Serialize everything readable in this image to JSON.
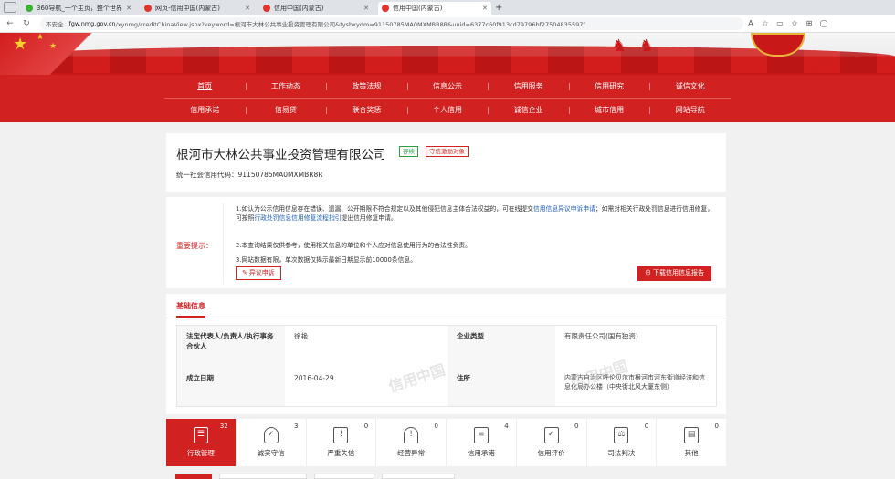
{
  "browser": {
    "tabs": [
      {
        "title": "360导航_一个主页，整个世界",
        "active": false
      },
      {
        "title": "网页-信用中国(内蒙古)",
        "active": false
      },
      {
        "title": "信用中国(内蒙古)",
        "active": false
      },
      {
        "title": "信用中国(内蒙古)",
        "active": true
      }
    ],
    "address": {
      "security": "不安全",
      "host": "fgw.nmg.gov.cn",
      "path": "/xynmg/creditChinaView.jspx?keyword=根河市大林公共事业投资管理有限公司&tyshxydm=91150785MA0MXMBR8R&uuid=6377c60f913cd79796bf27504835597f"
    }
  },
  "nav": {
    "row1": [
      "首页",
      "工作动态",
      "政策法规",
      "信息公示",
      "信用服务",
      "信用研究",
      "诚信文化"
    ],
    "row2": [
      "信用承诺",
      "信易贷",
      "联合奖惩",
      "个人信用",
      "诚信企业",
      "城市信用",
      "网站导航"
    ]
  },
  "company": {
    "name": "根河市大林公共事业投资管理有限公司",
    "status_badge": "存续",
    "credit_badge": "守信激励对象",
    "uscc_label": "统一社会信用代码：",
    "uscc": "91150785MA0MXMBR8R"
  },
  "notice": {
    "label": "重要提示：",
    "line1_a": "1.如认为公示信用信息存在错误、遗漏、公开期限不符合规定以及其他侵犯信息主体合法权益的，可在线提交",
    "line1_link1": "信用信息异议申诉申请",
    "line1_b": "；如需对相关行政处罚信息进行信用修复，可按照",
    "line1_link2": "行政处罚信息信用修复流程指引",
    "line1_c": "提出信用修复申请。",
    "line2": "2.本查询结果仅供参考，使用相关信息的单位和个人应对信息使用行为的合法性负责。",
    "line3": "3.网站数据有限，单次数据仅揭示最新日期显示前10000条信息。",
    "objection_button": "异议申诉",
    "download_button": "下载信用信息报告"
  },
  "basic": {
    "title": "基础信息",
    "legal_rep_label": "法定代表人/负责人/执行事务合伙人",
    "legal_rep_value": "徐艳",
    "type_label": "企业类型",
    "type_value": "有限责任公司(国有独资)",
    "date_label": "成立日期",
    "date_value": "2016-04-29",
    "address_label": "住所",
    "address_value": "内蒙古自治区呼伦贝尔市根河市河东街道经济和信息化局办公楼（中央街北风大厦东侧）",
    "watermark": "信用中国"
  },
  "tiles": [
    {
      "label": "行政管理",
      "count": "32",
      "icon": "admin-icon",
      "active": true
    },
    {
      "label": "诚实守信",
      "count": "3",
      "icon": "shield-icon",
      "active": false
    },
    {
      "label": "严重失信",
      "count": "0",
      "icon": "warning-icon",
      "active": false
    },
    {
      "label": "经营异常",
      "count": "0",
      "icon": "alarm-icon",
      "active": false
    },
    {
      "label": "信用承诺",
      "count": "4",
      "icon": "document-icon",
      "active": false
    },
    {
      "label": "信用评价",
      "count": "0",
      "icon": "rating-icon",
      "active": false
    },
    {
      "label": "司法判决",
      "count": "0",
      "icon": "gavel-icon",
      "active": false
    },
    {
      "label": "其他",
      "count": "0",
      "icon": "other-icon",
      "active": false
    }
  ],
  "colors": {
    "primary": "#d12121",
    "link": "#1f5fbf",
    "ok": "#2e9e3f"
  }
}
